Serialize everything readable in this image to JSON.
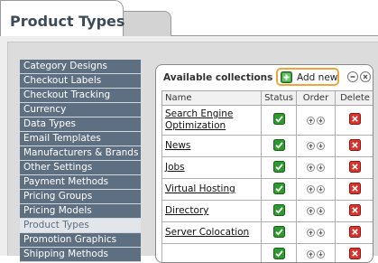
{
  "tabs": {
    "active_label": "Product Types"
  },
  "sidebar": {
    "items": [
      {
        "label": "Category Designs",
        "active": false
      },
      {
        "label": "Checkout Labels",
        "active": false
      },
      {
        "label": "Checkout Tracking",
        "active": false
      },
      {
        "label": "Currency",
        "active": false
      },
      {
        "label": "Data Types",
        "active": false
      },
      {
        "label": "Email Templates",
        "active": false
      },
      {
        "label": "Manufacturers & Brands",
        "active": false
      },
      {
        "label": "Other Settings",
        "active": false
      },
      {
        "label": "Payment Methods",
        "active": false
      },
      {
        "label": "Pricing Groups",
        "active": false
      },
      {
        "label": "Pricing Models",
        "active": false
      },
      {
        "label": "Product Types",
        "active": true
      },
      {
        "label": "Promotion Graphics",
        "active": false
      },
      {
        "label": "Shipping Methods",
        "active": false
      }
    ]
  },
  "panel": {
    "title": "Available collections",
    "add_new_label": "Add new",
    "columns": {
      "name": "Name",
      "status": "Status",
      "order": "Order",
      "delete": "Delete"
    },
    "rows": [
      {
        "name": "Search Engine Optimization",
        "status": "enabled"
      },
      {
        "name": "News",
        "status": "enabled"
      },
      {
        "name": "Jobs",
        "status": "enabled"
      },
      {
        "name": "Virtual Hosting",
        "status": "enabled"
      },
      {
        "name": "Directory",
        "status": "enabled"
      },
      {
        "name": "Server Colocation",
        "status": "enabled"
      },
      {
        "name": "",
        "status": "enabled"
      }
    ]
  },
  "colors": {
    "sidebar_bg": "#5d6f80",
    "sidebar_active_bg": "#e2e6ea",
    "highlight_border": "#f0a53b",
    "status_green": "#2e9a2e",
    "delete_red": "#d9342b"
  },
  "icons": {
    "add_new": "add-icon",
    "status": "check-icon",
    "order_up": "arrow-up-icon",
    "order_down": "arrow-down-icon",
    "delete": "delete-x-icon",
    "panel_minimize": "minimize-icon",
    "panel_close": "close-icon"
  }
}
